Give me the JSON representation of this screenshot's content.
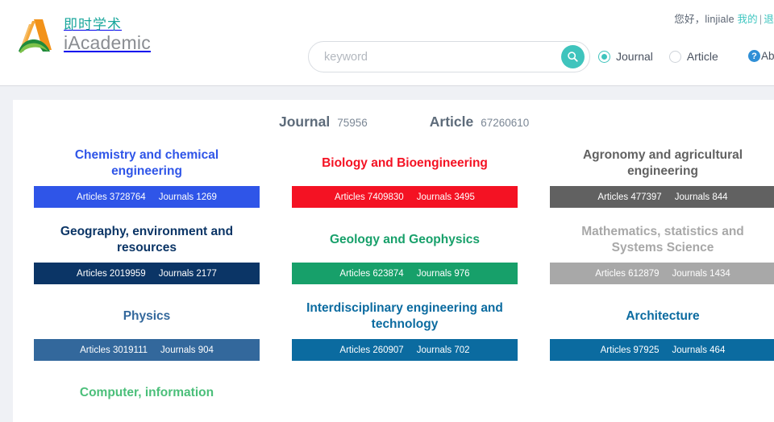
{
  "header": {
    "greeting_prefix": "您好，linjiale",
    "my_link": "我的",
    "separator": "|",
    "logout_link": "退",
    "logo": {
      "cn": "即时学术",
      "en": "iAcademic",
      "mark_icon": "academic-a-logo-icon"
    },
    "search": {
      "placeholder": "keyword",
      "value": "",
      "button_icon": "search-icon"
    },
    "modes": [
      {
        "label": "Journal",
        "selected": true
      },
      {
        "label": "Article",
        "selected": false
      }
    ],
    "help": {
      "icon": "question-mark-icon",
      "label": "Ab",
      "glyph": "?"
    }
  },
  "totals": [
    {
      "label": "Journal",
      "value": "75956"
    },
    {
      "label": "Article",
      "value": "67260610"
    }
  ],
  "labels": {
    "articles": "Articles",
    "journals": "Journals"
  },
  "categories": [
    {
      "title": "Chemistry and chemical engineering",
      "articles": "Articles 3728764",
      "journals": "Journals 1269",
      "color": "#2f55e8"
    },
    {
      "title": "Biology and Bioengineering",
      "articles": "Articles 7409830",
      "journals": "Journals 3495",
      "color": "#f41223"
    },
    {
      "title": "Agronomy and agricultural engineering",
      "articles": "Articles 477397",
      "journals": "Journals 844",
      "color": "#616161"
    },
    {
      "title": "Geography, environment and resources",
      "articles": "Articles 2019959",
      "journals": "Journals 2177",
      "color": "#0b3566"
    },
    {
      "title": "Geology and Geophysics",
      "articles": "Articles 623874",
      "journals": "Journals 976",
      "color": "#17a06a"
    },
    {
      "title": "Mathematics, statistics and Systems Science",
      "articles": "Articles 612879",
      "journals": "Journals 1434",
      "color": "#a8a8a8"
    },
    {
      "title": "Physics",
      "articles": "Articles 3019111",
      "journals": "Journals 904",
      "color": "#33689c"
    },
    {
      "title": "Interdisciplinary engineering and technology",
      "articles": "Articles 260907",
      "journals": "Journals 702",
      "color": "#0b6ba0"
    },
    {
      "title": "Architecture",
      "articles": "Articles 97925",
      "journals": "Journals 464",
      "color": "#0b6ba0"
    },
    {
      "title": "Computer, information",
      "articles": "",
      "journals": "",
      "color": "#4bbf7a"
    }
  ]
}
